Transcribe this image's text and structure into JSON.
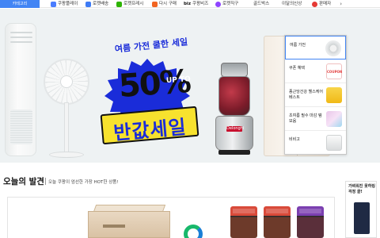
{
  "nav": {
    "category_label": "카테고리",
    "items": [
      {
        "label": "쿠팡플레이",
        "icon": "play-icon",
        "color": "#4a7dff"
      },
      {
        "label": "로켓배송",
        "icon": "rocket-icon",
        "color": "#3d7bf5"
      },
      {
        "label": "로켓프레시",
        "icon": "fresh-icon",
        "color": "#2db400"
      },
      {
        "label": "다시 구매",
        "icon": "reorder-icon",
        "color": "#f26522"
      },
      {
        "label": "쿠팡비즈",
        "icon": "biz-icon",
        "color": "#111111",
        "prefix": "biz"
      },
      {
        "label": "로켓직구",
        "icon": "global-icon",
        "color": "#8e44ff"
      },
      {
        "label": "골드박스",
        "icon": "",
        "color": ""
      },
      {
        "label": "이달의신상",
        "icon": "",
        "color": ""
      },
      {
        "label": "판매자",
        "icon": "seller-icon",
        "color": "#e53935"
      }
    ],
    "next_arrow": "›"
  },
  "banner": {
    "headline": "여름 가전 쿨한 세일",
    "percent": "50%",
    "upto": "UP TO",
    "half_price": "반값세일",
    "blender_brand": "Delonghi"
  },
  "promo_panel": {
    "items": [
      {
        "label": "여름 가전",
        "thumb": "fan-thumb"
      },
      {
        "label": "쿠폰 혜택",
        "thumb": "coupon-thumb",
        "thumb_text": "COUPON"
      },
      {
        "label": "종근당건강 헬스케어 베스트",
        "thumb": "health-thumb"
      },
      {
        "label": "초여름 필수 마감 템 모음",
        "thumb": "cosmetic-thumb"
      },
      {
        "label": "비비고",
        "thumb": "bibigo-thumb"
      }
    ]
  },
  "section": {
    "title": "오늘의 발견",
    "subtitle": "오늘 쿠팡이 엄선한 가장 HOT한 상품!"
  },
  "side_ad": {
    "text": "가벼워진 못하링 걱정 끝!"
  }
}
